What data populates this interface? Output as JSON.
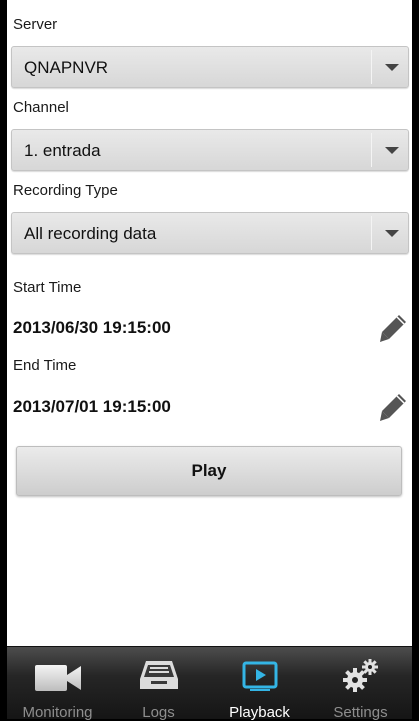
{
  "form": {
    "server": {
      "label": "Server",
      "value": "QNAPNVR"
    },
    "channel": {
      "label": "Channel",
      "value": "1. entrada"
    },
    "recording_type": {
      "label": "Recording Type",
      "value": "All recording data"
    },
    "start_time": {
      "label": "Start Time",
      "value": "2013/06/30 19:15:00"
    },
    "end_time": {
      "label": "End Time",
      "value": "2013/07/01 19:15:00"
    },
    "play_label": "Play"
  },
  "tabs": [
    {
      "label": "Monitoring",
      "icon": "video-camera-icon",
      "active": false
    },
    {
      "label": "Logs",
      "icon": "inbox-tray-icon",
      "active": false
    },
    {
      "label": "Playback",
      "icon": "play-screen-icon",
      "active": true
    },
    {
      "label": "Settings",
      "icon": "gears-icon",
      "active": false
    }
  ],
  "colors": {
    "accent": "#34b5e5",
    "tab_active_text": "#ffffff",
    "tab_inactive_text": "#8e8e8e"
  }
}
